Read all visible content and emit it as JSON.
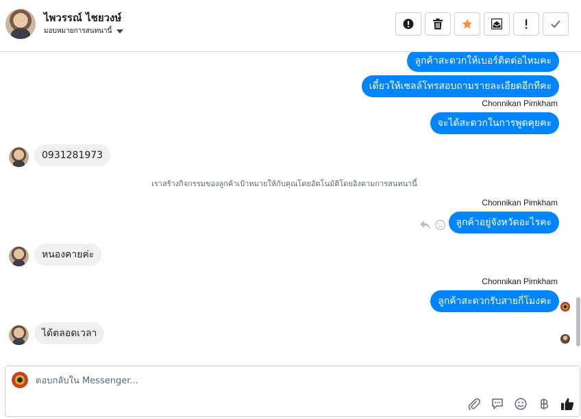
{
  "header": {
    "contact_name": "ไพวรรณ์ ไชยวงษ์",
    "assign_label": "มอบหมายการสนทนานี้",
    "toolbar": {
      "spam_icon": "alert-circle-icon",
      "delete_icon": "trash-icon",
      "star_icon": "star-icon",
      "unread_icon": "envelope-icon",
      "follow_up_icon": "exclamation-icon",
      "done_icon": "check-icon"
    },
    "star_color": "#f7923b"
  },
  "conversation": {
    "outgoing_top": [
      {
        "text": "ลูกค้าสะดวกให้เบอร์ติดต่อไหมคะ"
      },
      {
        "text": "เดี๋ยวให้เซลล์โทรสอบถามรายละเอียดอีกทีคะ"
      }
    ],
    "sender_name_1": "Chonnikan Pimkham",
    "outgoing_1": "จะได้สะดวกในการพูดคุยคะ",
    "incoming_1": "0931281973",
    "system_note": "เราสร้างกิจกรรมของลูกค้าเป้าหมายให้กับคุณโดยอัตโนมัติโดยอิงตามการสนทนานี้",
    "sender_name_2": "Chonnikan Pimkham",
    "outgoing_2": "ลูกค้าอยู่จังหวัดอะไรคะ",
    "incoming_2": "หนองคายค่ะ",
    "sender_name_3": "Chonnikan Pimkham",
    "outgoing_3": "ลูกค้าสะดวกรับสายกี่โมงคะ",
    "incoming_3": "ได้ตลอดเวลา",
    "bubble_color": "#0084ff"
  },
  "composer": {
    "placeholder": "ตอบกลับใน Messenger...",
    "tools": [
      "paperclip-icon",
      "speech-bubble-icon",
      "emoji-icon",
      "baht-icon",
      "thumbs-up-icon"
    ]
  }
}
